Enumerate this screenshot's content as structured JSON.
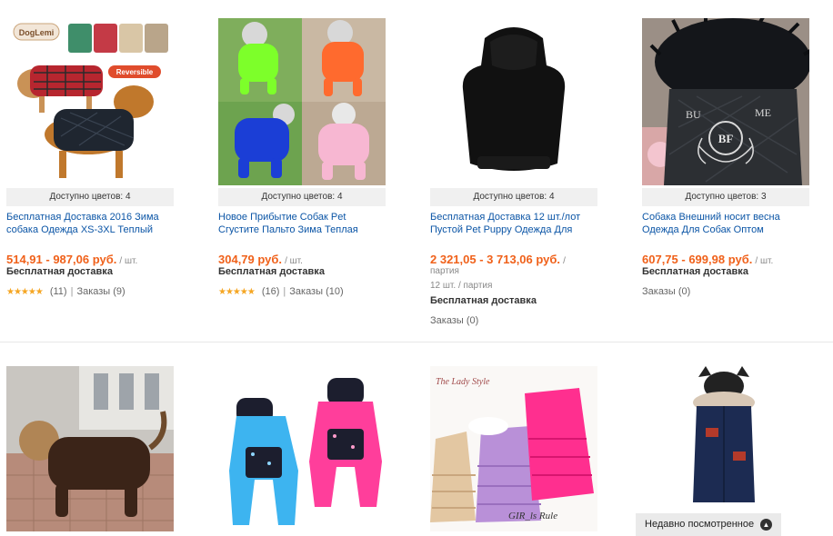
{
  "products": [
    {
      "image_label": "product-image-plaid-dog-coats",
      "logo_text": "DogLemi",
      "badge_text": "Reversible",
      "available_colors": "Доступно цветов: 4",
      "title": "Бесплатная Доставка 2016 Зима собака Одежда XS-3XL Теплый",
      "price": "514,91 - 987,06 руб.",
      "unit": "/ шт.",
      "shipping": "Бесплатная доставка",
      "rating_count": "(11)",
      "orders": "Заказы (9)"
    },
    {
      "image_label": "product-image-puffer-jumpsuits",
      "available_colors": "Доступно цветов: 4",
      "title": "Новое Прибытие Собак Pet Сгустите Пальто Зима Теплая",
      "price": "304,79 руб.",
      "unit": "/ шт.",
      "shipping": "Бесплатная доставка",
      "rating_count": "(16)",
      "orders": "Заказы (10)"
    },
    {
      "image_label": "product-image-black-hoodie",
      "available_colors": "Доступно цветов: 4",
      "title": "Бесплатная Доставка 12 шт./лот Пустой Pet Puppy Одежда Для",
      "price": "2 321,05 - 3 713,06 руб.",
      "unit": "/",
      "unit2": "партия",
      "lot_info": "12 шт. / партия",
      "shipping": "Бесплатная доставка",
      "orders": "Заказы (0)"
    },
    {
      "image_label": "product-image-fur-hood-jacket",
      "jacket_text_left": "BU",
      "jacket_text_right": "ME",
      "emblem_text": "BF",
      "available_colors": "Доступно цветов: 3",
      "title": "Собака Внешний носит весна Одежда Для Собак Оптом",
      "price": "607,75 - 699,98 руб.",
      "unit": "/ шт.",
      "shipping": "Бесплатная доставка",
      "orders": "Заказы (0)"
    }
  ],
  "second_row": [
    {
      "image_label": "product-image-yorkie-brown-suit"
    },
    {
      "image_label": "product-image-blue-pink-star-suits"
    },
    {
      "image_label": "product-image-ruffle-dresses",
      "caption_top": "The Lady Style",
      "caption_bottom": "GIR_ls Rule"
    },
    {
      "image_label": "product-image-navy-fur-parka"
    }
  ],
  "recently_viewed": {
    "label": "Недавно посмотренное"
  },
  "stars": "★★★★★",
  "colors": {
    "price": "#f0611a",
    "link": "#0b55a6",
    "star": "#f5a623"
  }
}
